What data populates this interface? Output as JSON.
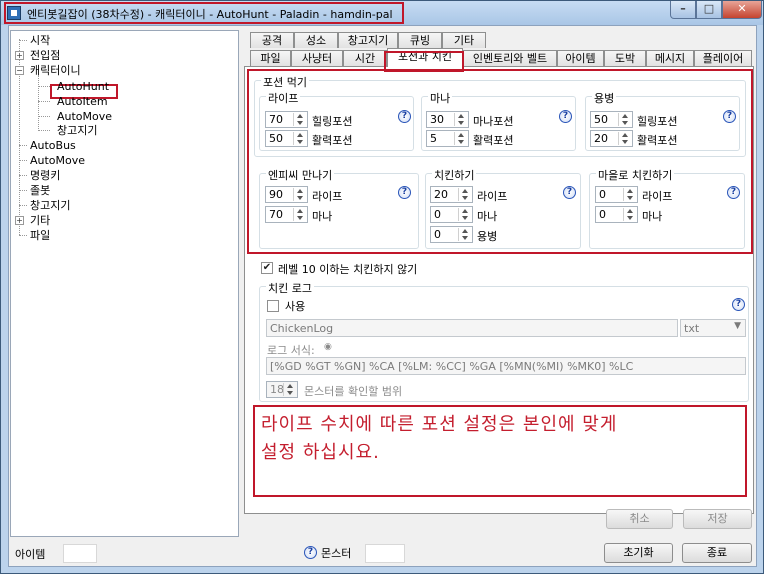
{
  "window": {
    "title": "엔티봇길잡이 (38차수정) - 캐릭터이니 - AutoHunt - Paladin - hamdin-pal",
    "min": "–",
    "max": "□",
    "close": "✕"
  },
  "tree": {
    "items": [
      "시작",
      "전입점",
      "캐릭터이니",
      "AutoHunt",
      "AutoItem",
      "AutoMove",
      "창고지기",
      "AutoBus",
      "AutoMove",
      "명령키",
      "졸봇",
      "창고지기",
      "기타",
      "파일"
    ]
  },
  "tabs": {
    "row1": [
      "공격",
      "성소",
      "창고지기",
      "큐빙",
      "기타"
    ],
    "row2": [
      "파일",
      "사냥터",
      "시간",
      "포션과 치킨",
      "인벤토리와 벨트",
      "아이템",
      "도박",
      "메시지",
      "플레이어"
    ],
    "active": "포션과 치킨"
  },
  "potion": {
    "title": "포션 먹기",
    "life": {
      "title": "라이프",
      "rows": [
        {
          "value": "70",
          "label": "힐링포션"
        },
        {
          "value": "50",
          "label": "활력포션"
        }
      ]
    },
    "mana": {
      "title": "마나",
      "rows": [
        {
          "value": "30",
          "label": "마나포션"
        },
        {
          "value": "5",
          "label": "활력포션"
        }
      ]
    },
    "merc": {
      "title": "용병",
      "rows": [
        {
          "value": "50",
          "label": "힐링포션"
        },
        {
          "value": "20",
          "label": "활력포션"
        }
      ]
    }
  },
  "emp": {
    "title": "엔피씨 만나기",
    "rows": [
      {
        "value": "90",
        "label": "라이프"
      },
      {
        "value": "70",
        "label": "마나"
      }
    ]
  },
  "chicken": {
    "title": "치킨하기",
    "rows": [
      {
        "value": "20",
        "label": "라이프"
      },
      {
        "value": "0",
        "label": "마나"
      },
      {
        "value": "0",
        "label": "용병"
      }
    ]
  },
  "town": {
    "title": "마을로 치킨하기",
    "rows": [
      {
        "value": "0",
        "label": "라이프"
      },
      {
        "value": "0",
        "label": "마나"
      }
    ]
  },
  "level_check": {
    "label": "레벨 10 이하는 치킨하지 않기",
    "checked": "✔"
  },
  "chicken_log": {
    "title": "치킨 로그",
    "use_label": "사용",
    "file": "ChickenLog",
    "ext": "txt",
    "format_label": "로그 서식:",
    "format_value": "[%GD %GT %GN] %CA [%LM: %CC] %GA [%MN(%MI) %MK0] %LC",
    "range_value": "18",
    "range_label": "몬스터를 확인할 범위"
  },
  "notice": {
    "line1": "라이프 수치에 따른 포션 설정은 본인에 맞게",
    "line2": "설정 하십시요."
  },
  "buttons": {
    "cancel": "취소",
    "save": "저장",
    "reset": "초기화",
    "exit": "종료"
  },
  "status": {
    "item_label": "아이템",
    "monster_label": "몬스터"
  },
  "help_glyph": "?"
}
